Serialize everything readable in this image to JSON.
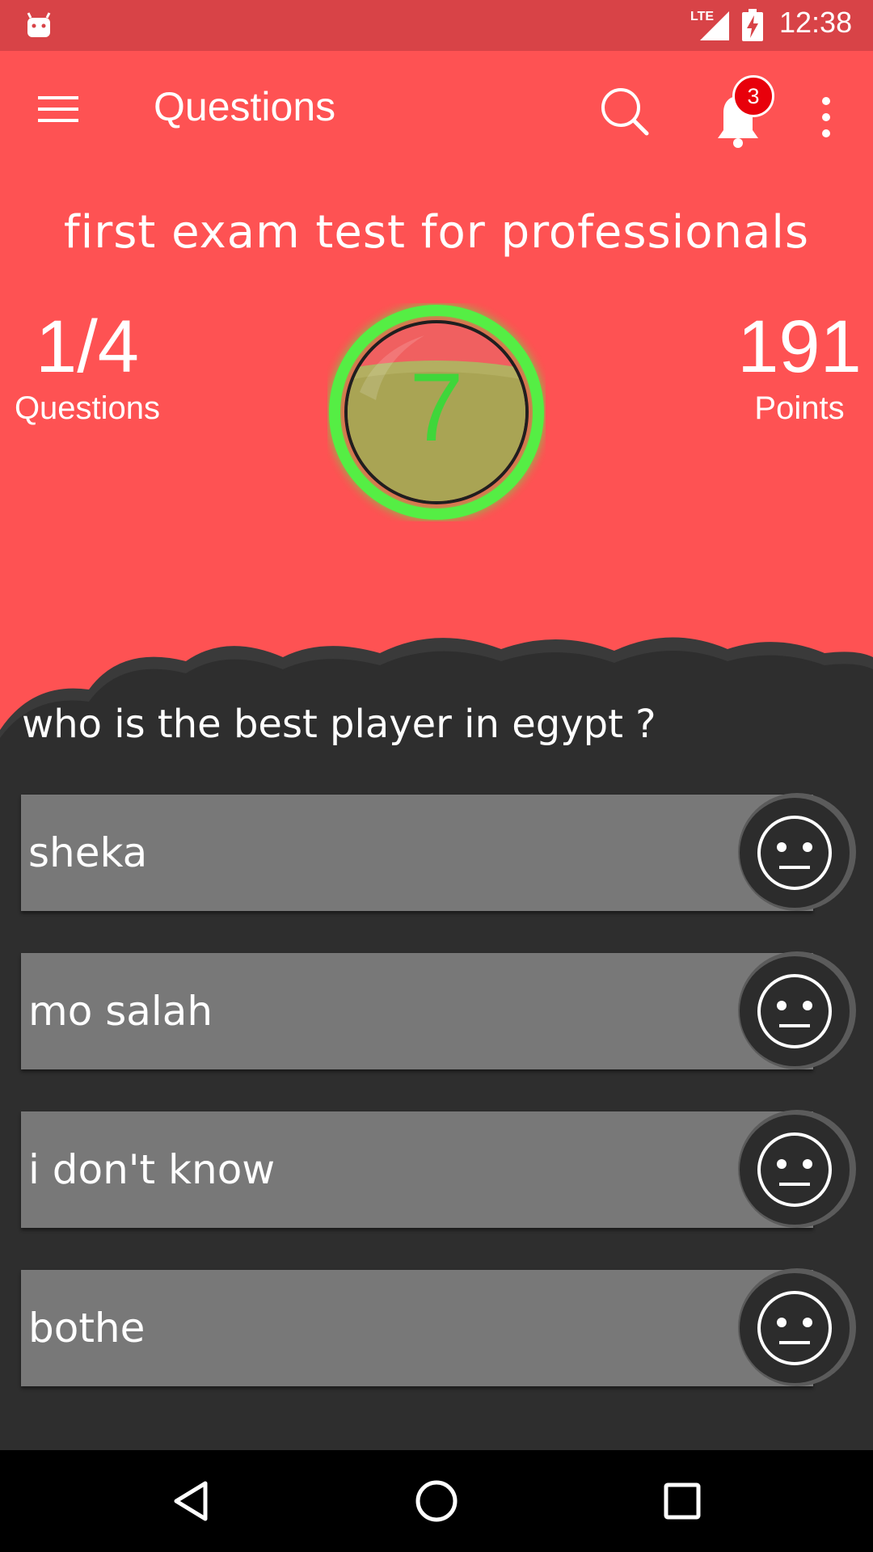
{
  "status_bar": {
    "network": "LTE",
    "time": "12:38",
    "icons": [
      "android-icon",
      "signal-icon",
      "battery-charging-icon"
    ]
  },
  "toolbar": {
    "title": "Questions",
    "notification_count": "3",
    "icons": [
      "menu-icon",
      "search-icon",
      "bell-icon",
      "more-vert-icon"
    ]
  },
  "exam": {
    "title": "first exam test for professionals",
    "question_progress": "1/4",
    "question_label": "Questions",
    "points": "191",
    "points_label": "Points",
    "timer_value": "7"
  },
  "question": {
    "text": "who is the best player in egypt ?",
    "answers": [
      {
        "label": "sheka",
        "icon": "neutral-face-icon"
      },
      {
        "label": "mo salah",
        "icon": "neutral-face-icon"
      },
      {
        "label": "i don't know",
        "icon": "neutral-face-icon"
      },
      {
        "label": "bothe",
        "icon": "neutral-face-icon"
      }
    ]
  },
  "nav_bar": {
    "icons": [
      "back-icon",
      "home-icon",
      "recents-icon"
    ]
  },
  "colors": {
    "header": "#fe5253",
    "status_bar": "#d84347",
    "background": "#2e2e2e",
    "answer_bar": "#787878",
    "timer_ring": "#55ee44",
    "badge": "#e8000b"
  }
}
